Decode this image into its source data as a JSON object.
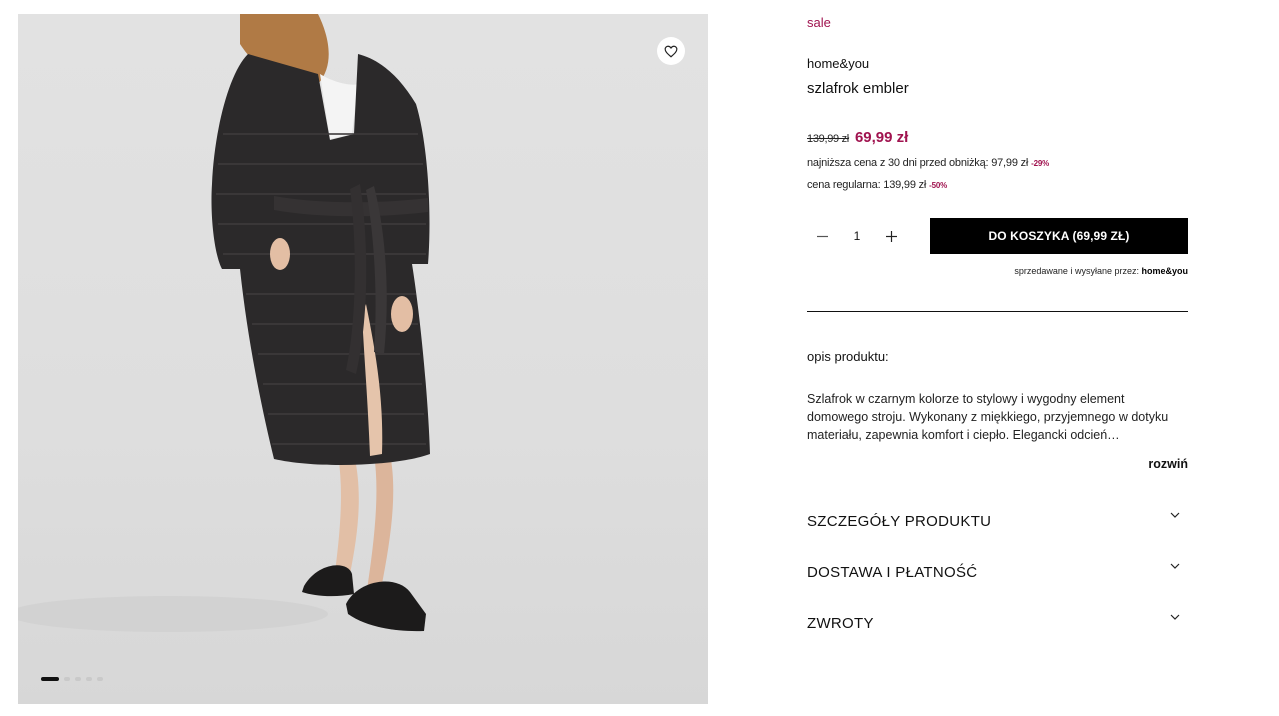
{
  "gallery": {
    "wishlist_icon": "heart-icon",
    "slide_count": 5,
    "active_slide": 1
  },
  "product": {
    "badge": "sale",
    "brand": "home&you",
    "name": "szlafrok embler",
    "old_price": "139,99 zł",
    "price": "69,99 zł",
    "lowest_price_text": "najniższa cena z 30 dni przed obniżką: 97,99 zł",
    "lowest_price_discount": "-29%",
    "regular_price_text": "cena regularna: 139,99 zł",
    "regular_price_discount": "-50%",
    "accent_color": "#a0134f"
  },
  "purchase": {
    "quantity": "1",
    "decrease_icon": "minus-icon",
    "increase_icon": "plus-icon",
    "cart_button": "DO KOSZYKA  (69,99 ZŁ)",
    "seller_label": "sprzedawane i wysyłane przez:",
    "seller_name": "home&you"
  },
  "description": {
    "label": "opis produktu:",
    "text": "Szlafrok w czarnym kolorze to stylowy i wygodny element domowego stroju. Wykonany z miękkiego, przyjemnego w dotyku materiału, zapewnia komfort i ciepło. Elegancki odcień…",
    "expand": "rozwiń"
  },
  "accordion": [
    {
      "title": "SZCZEGÓŁY PRODUKTU",
      "icon": "chevron-down-icon"
    },
    {
      "title": "DOSTAWA I PŁATNOŚĆ",
      "icon": "chevron-down-icon"
    },
    {
      "title": "ZWROTY",
      "icon": "chevron-down-icon"
    }
  ]
}
